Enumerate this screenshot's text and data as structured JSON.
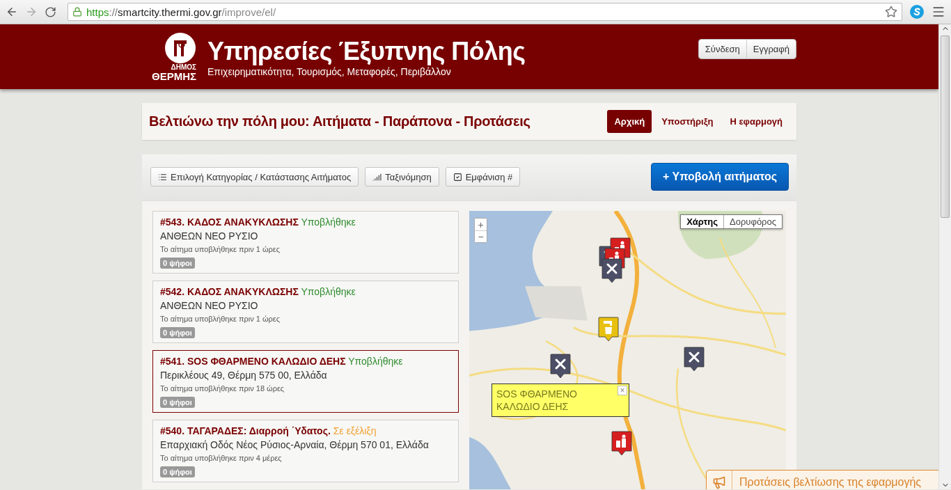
{
  "browser": {
    "url": {
      "scheme": "https",
      "separator": "://",
      "host": "smartcity.thermi.gov.gr",
      "path": "/improve/el/"
    }
  },
  "header": {
    "logo_lines": [
      "ΔΗΜΟΣ",
      "ΘΕΡΜΗΣ"
    ],
    "title": "Υπηρεσίες Έξυπνης Πόλης",
    "subtitle": "Επιχειρηματικότητα, Τουρισμός, Μεταφορές, Περιβάλλον",
    "account_buttons": [
      "Σύνδεση",
      "Εγγραφή"
    ]
  },
  "page_bar": {
    "title": "Βελτιώνω την πόλη μου: Αιτήματα - Παράπονα - Προτάσεις",
    "nav": [
      {
        "label": "Αρχική",
        "selected": true
      },
      {
        "label": "Υποστήριξη",
        "selected": false
      },
      {
        "label": "Η εφαρμογή",
        "selected": false
      }
    ]
  },
  "toolbar": {
    "buttons": [
      {
        "kind": "filter",
        "label": "Επιλογή Κατηγορίας / Κατάστασης Αιτήματος"
      },
      {
        "kind": "sort",
        "label": "Ταξινόμηση"
      },
      {
        "kind": "show",
        "label": "Εμφάνιση #"
      }
    ],
    "submit": "+ Υποβολή αιτήματος"
  },
  "requests": [
    {
      "title": "#543. ΚΑΔΟΣ ΑΝΑΚΥΚΛΩΣΗΣ",
      "status": "Υποβλήθηκε",
      "color": "#2e8b2e",
      "address": "ΑΝΘΕΩΝ ΝΕΟ ΡΥΣΙΟ",
      "time": "Το αίτημα υποβλήθηκε πριν 1 ώρες",
      "votes": "0 ψήφοι",
      "selected": false
    },
    {
      "title": "#542. ΚΑΔΟΣ ΑΝΑΚΥΚΛΩΣΗΣ",
      "status": "Υποβλήθηκε",
      "color": "#2e8b2e",
      "address": "ΑΝΘΕΩΝ ΝΕΟ ΡΥΣΙΟ",
      "time": "Το αίτημα υποβλήθηκε πριν 1 ώρες",
      "votes": "0 ψήφοι",
      "selected": false
    },
    {
      "title": "#541. SOS ΦΘΑΡΜΕΝΟ ΚΑΛΩΔΙΟ ΔΕΗΣ",
      "status": "Υποβλήθηκε",
      "color": "#2e8b2e",
      "address": "Περικλέους 49, Θέρμη 575 00, Ελλάδα",
      "time": "Το αίτημα υποβλήθηκε πριν 18 ώρες",
      "votes": "0 ψήφοι",
      "selected": true
    },
    {
      "title": "#540. ΤΑΓΑΡΑΔΕΣ: Διαρροή ΄Υδατος.",
      "status": "Σε εξέλιξη",
      "color": "#f0a030",
      "address": "Επαρχιακή Οδός Νέος Ρύσιος-Αρναία, Θέρμη 570 01, Ελλάδα",
      "time": "Το αίτημα υποβλήθηκε πριν 4 μέρες",
      "votes": "0 ψήφοι",
      "selected": false
    }
  ],
  "map": {
    "map_types": [
      {
        "label": "Χάρτης",
        "selected": true
      },
      {
        "label": "Δορυφόρος",
        "selected": false
      }
    ],
    "zoom": [
      "+",
      "−"
    ],
    "markers": [
      {
        "kind": "cluster"
      },
      {
        "kind": "water"
      },
      {
        "kind": "repair"
      },
      {
        "kind": "repair"
      },
      {
        "kind": "trash"
      }
    ],
    "popup": {
      "text": "SOS ΦΘΑΡΜΕΝΟ ΚΑΛΩΔΙΟ ΔΕΗΣ",
      "close": "×"
    }
  },
  "feedback_tab": {
    "label": "Προτάσεις βελτίωσης της εφαρμογής"
  }
}
